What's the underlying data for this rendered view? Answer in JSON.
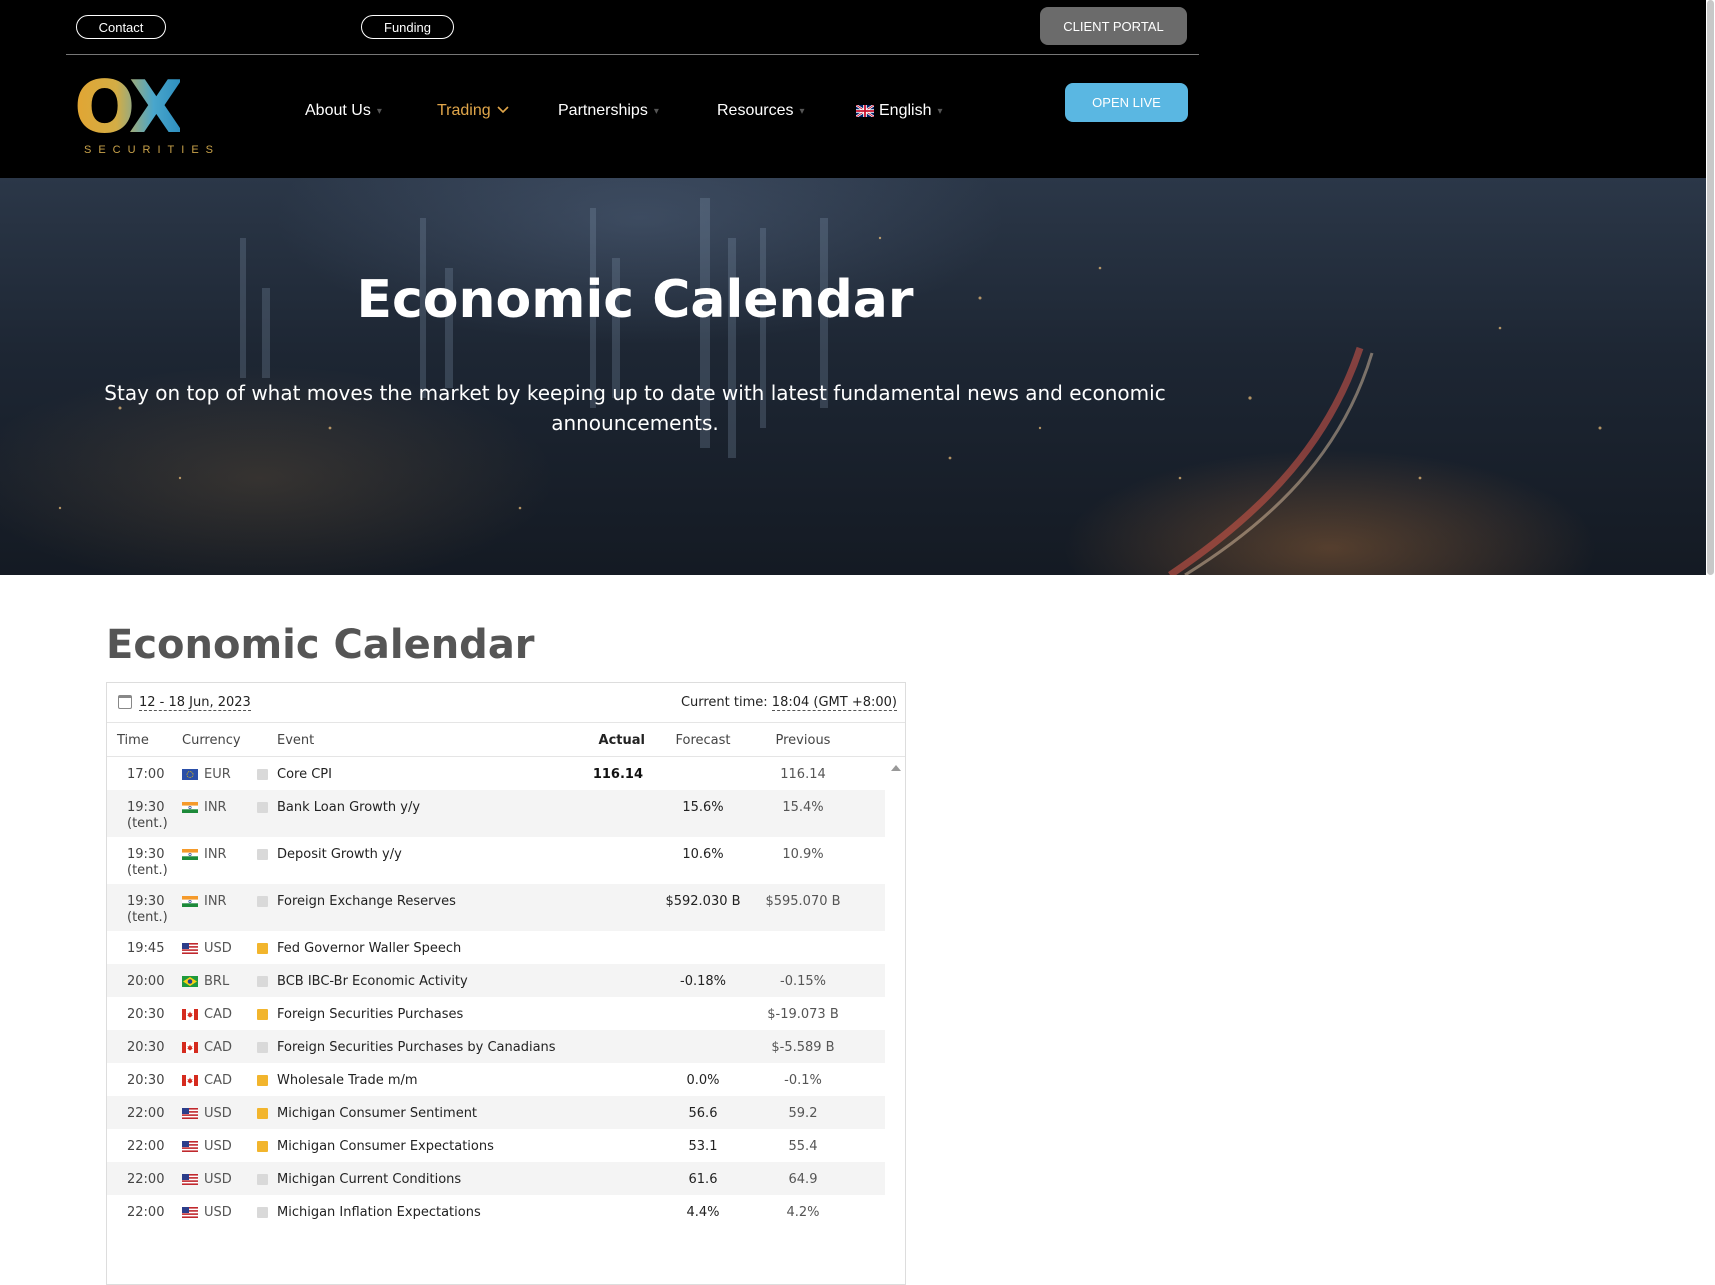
{
  "header": {
    "contact_label": "Contact",
    "funding_label": "Funding",
    "client_portal_label": "CLIENT PORTAL",
    "open_live_label": "OPEN LIVE",
    "logo_text": "OX",
    "logo_sub": "SECURITIES",
    "nav": [
      {
        "label": "About Us"
      },
      {
        "label": "Trading"
      },
      {
        "label": "Partnerships"
      },
      {
        "label": "Resources"
      },
      {
        "label": "English"
      }
    ],
    "active_nav": "Trading"
  },
  "hero": {
    "title": "Economic Calendar",
    "subtitle": "Stay on top of what moves the market by keeping up to date with latest fundamental news and economic announcements."
  },
  "section": {
    "title_light": "Economic",
    "title_bold": "Calendar"
  },
  "calendar": {
    "date_range": "12 - 18 Jun, 2023",
    "current_time_label": "Current time:",
    "current_time_value": "18:04 (GMT +8:00)",
    "columns": {
      "time": "Time",
      "currency": "Currency",
      "event": "Event",
      "actual": "Actual",
      "forecast": "Forecast",
      "previous": "Previous"
    },
    "rows": [
      {
        "time": "17:00",
        "tent": "",
        "flag": "eu-flag-icon",
        "currency": "EUR",
        "importance": "low",
        "event": "Core CPI",
        "actual": "116.14",
        "forecast": "",
        "previous": "116.14"
      },
      {
        "time": "19:30",
        "tent": "(tent.)",
        "flag": "india-flag-icon",
        "currency": "INR",
        "importance": "low",
        "event": "Bank Loan Growth y/y",
        "actual": "",
        "forecast": "15.6%",
        "previous": "15.4%"
      },
      {
        "time": "19:30",
        "tent": "(tent.)",
        "flag": "india-flag-icon",
        "currency": "INR",
        "importance": "low",
        "event": "Deposit Growth y/y",
        "actual": "",
        "forecast": "10.6%",
        "previous": "10.9%"
      },
      {
        "time": "19:30",
        "tent": "(tent.)",
        "flag": "india-flag-icon",
        "currency": "INR",
        "importance": "low",
        "event": "Foreign Exchange Reserves",
        "actual": "",
        "forecast": "$592.030 B",
        "previous": "$595.070 B"
      },
      {
        "time": "19:45",
        "tent": "",
        "flag": "us-flag-icon",
        "currency": "USD",
        "importance": "medium",
        "event": "Fed Governor Waller Speech",
        "actual": "",
        "forecast": "",
        "previous": ""
      },
      {
        "time": "20:00",
        "tent": "",
        "flag": "brazil-flag-icon",
        "currency": "BRL",
        "importance": "low",
        "event": "BCB IBC-Br Economic Activity",
        "actual": "",
        "forecast": "-0.18%",
        "previous": "-0.15%"
      },
      {
        "time": "20:30",
        "tent": "",
        "flag": "canada-flag-icon",
        "currency": "CAD",
        "importance": "medium",
        "event": "Foreign Securities Purchases",
        "actual": "",
        "forecast": "",
        "previous": "$-19.073 B"
      },
      {
        "time": "20:30",
        "tent": "",
        "flag": "canada-flag-icon",
        "currency": "CAD",
        "importance": "low",
        "event": "Foreign Securities Purchases by Canadians",
        "actual": "",
        "forecast": "",
        "previous": "$-5.589 B"
      },
      {
        "time": "20:30",
        "tent": "",
        "flag": "canada-flag-icon",
        "currency": "CAD",
        "importance": "medium",
        "event": "Wholesale Trade m/m",
        "actual": "",
        "forecast": "0.0%",
        "previous": "-0.1%"
      },
      {
        "time": "22:00",
        "tent": "",
        "flag": "us-flag-icon",
        "currency": "USD",
        "importance": "medium",
        "event": "Michigan Consumer Sentiment",
        "actual": "",
        "forecast": "56.6",
        "previous": "59.2"
      },
      {
        "time": "22:00",
        "tent": "",
        "flag": "us-flag-icon",
        "currency": "USD",
        "importance": "medium",
        "event": "Michigan Consumer Expectations",
        "actual": "",
        "forecast": "53.1",
        "previous": "55.4"
      },
      {
        "time": "22:00",
        "tent": "",
        "flag": "us-flag-icon",
        "currency": "USD",
        "importance": "low",
        "event": "Michigan Current Conditions",
        "actual": "",
        "forecast": "61.6",
        "previous": "64.9"
      },
      {
        "time": "22:00",
        "tent": "",
        "flag": "us-flag-icon",
        "currency": "USD",
        "importance": "low",
        "event": "Michigan Inflation Expectations",
        "actual": "",
        "forecast": "4.4%",
        "previous": "4.2%"
      }
    ]
  },
  "colors": {
    "accent_gold": "#e0a64a",
    "open_live_blue": "#5ab7e2",
    "client_portal_gray": "#6b6b6b",
    "importance_medium": "#f2b52d",
    "importance_low": "#d9d9d9"
  }
}
